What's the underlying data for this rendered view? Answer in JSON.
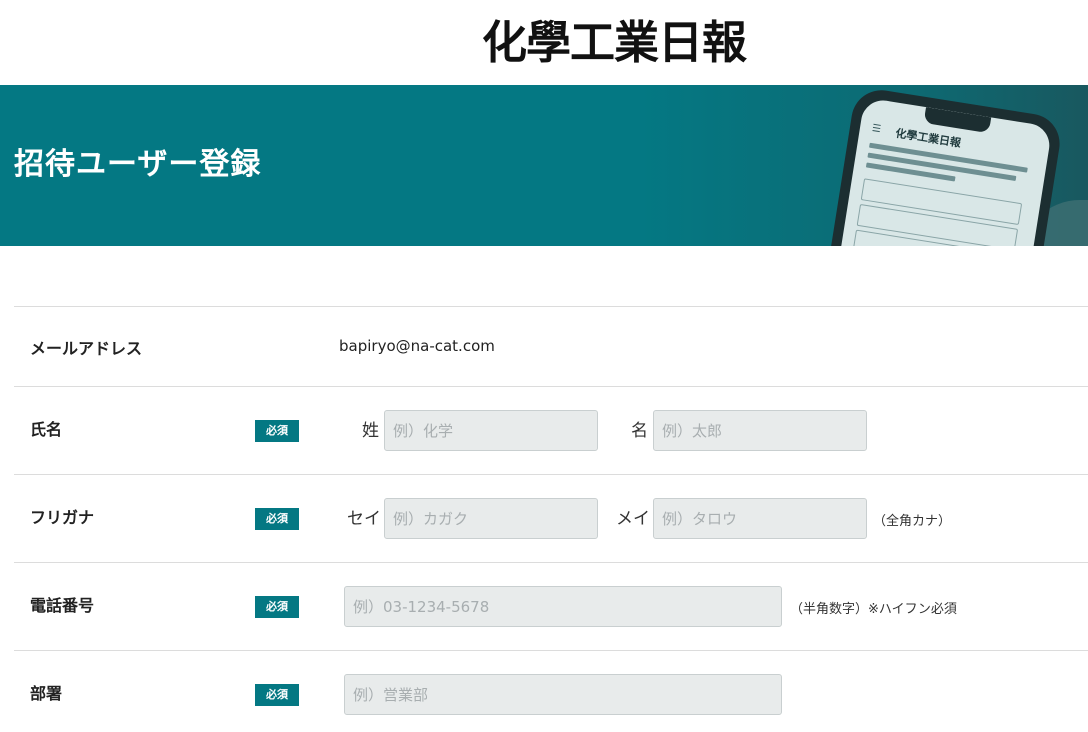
{
  "header": {
    "logo_text": "化學工業日報"
  },
  "hero": {
    "title": "招待ユーザー登録",
    "phone_title": "化學工業日報",
    "phone_menu": "☰"
  },
  "form": {
    "email": {
      "label": "メールアドレス",
      "value": "bapiryo@na-cat.com"
    },
    "name": {
      "label": "氏名",
      "badge": "必須",
      "last_prefix": "姓",
      "last_placeholder": "例）化学",
      "first_prefix": "名",
      "first_placeholder": "例）太郎"
    },
    "furigana": {
      "label": "フリガナ",
      "badge": "必須",
      "last_prefix": "セイ",
      "last_placeholder": "例）カガク",
      "first_prefix": "メイ",
      "first_placeholder": "例）タロウ",
      "note": "（全角カナ）"
    },
    "phone": {
      "label": "電話番号",
      "badge": "必須",
      "placeholder": "例）03-1234-5678",
      "note": "（半角数字）※ハイフン必須"
    },
    "department": {
      "label": "部署",
      "badge": "必須",
      "placeholder": "例）営業部"
    }
  },
  "colors": {
    "accent": "#047883",
    "input_bg": "#e8ebeb"
  }
}
